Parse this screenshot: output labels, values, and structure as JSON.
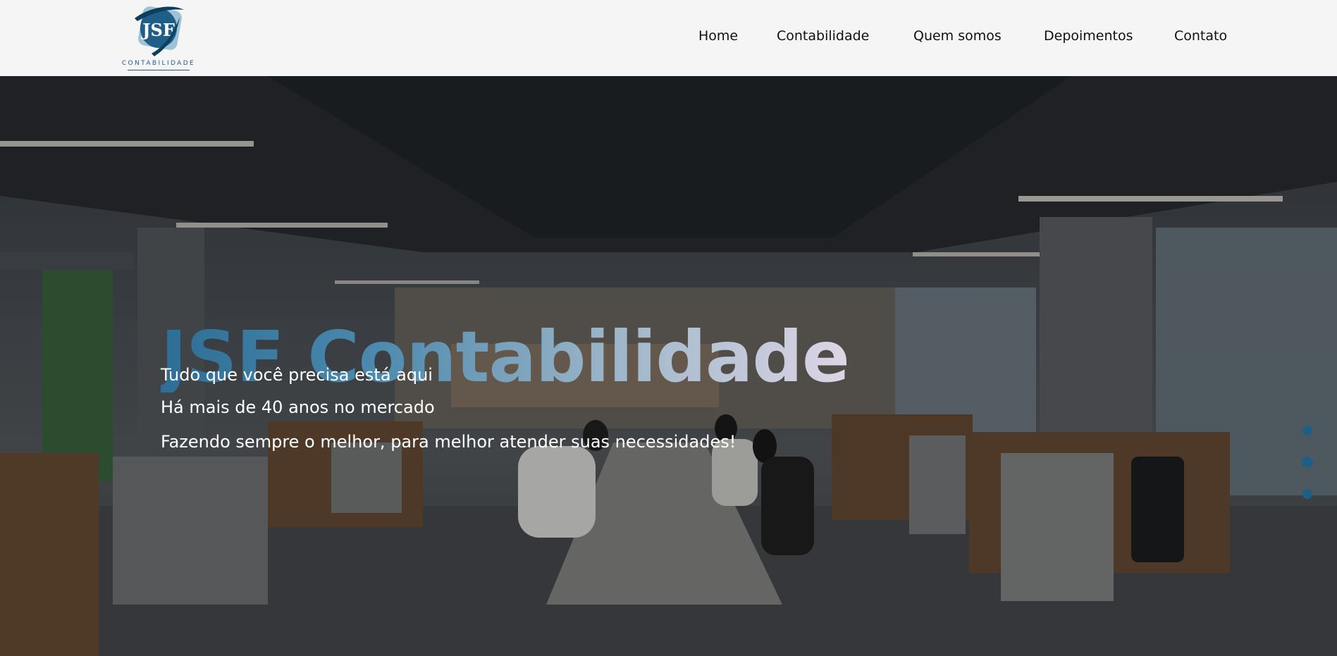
{
  "brand": {
    "logo_initials": "JSF",
    "logo_subtitle": "CONTABILIDADE",
    "accent_color": "#1f5f87"
  },
  "nav": {
    "items": [
      {
        "label": "Home"
      },
      {
        "label": "Contabilidade"
      },
      {
        "label": "Quem somos"
      },
      {
        "label": "Depoimentos"
      },
      {
        "label": "Contato"
      }
    ]
  },
  "hero": {
    "title": "JSF Contabilidade",
    "lines": [
      "Tudo que você precisa está aqui",
      "Há mais de 40 anos no mercado",
      "Fazendo sempre o melhor, para melhor atender suas necessidades!"
    ],
    "title_gradient": [
      "#2d6e96",
      "#ddd6e6"
    ],
    "carousel_slides": 3
  }
}
